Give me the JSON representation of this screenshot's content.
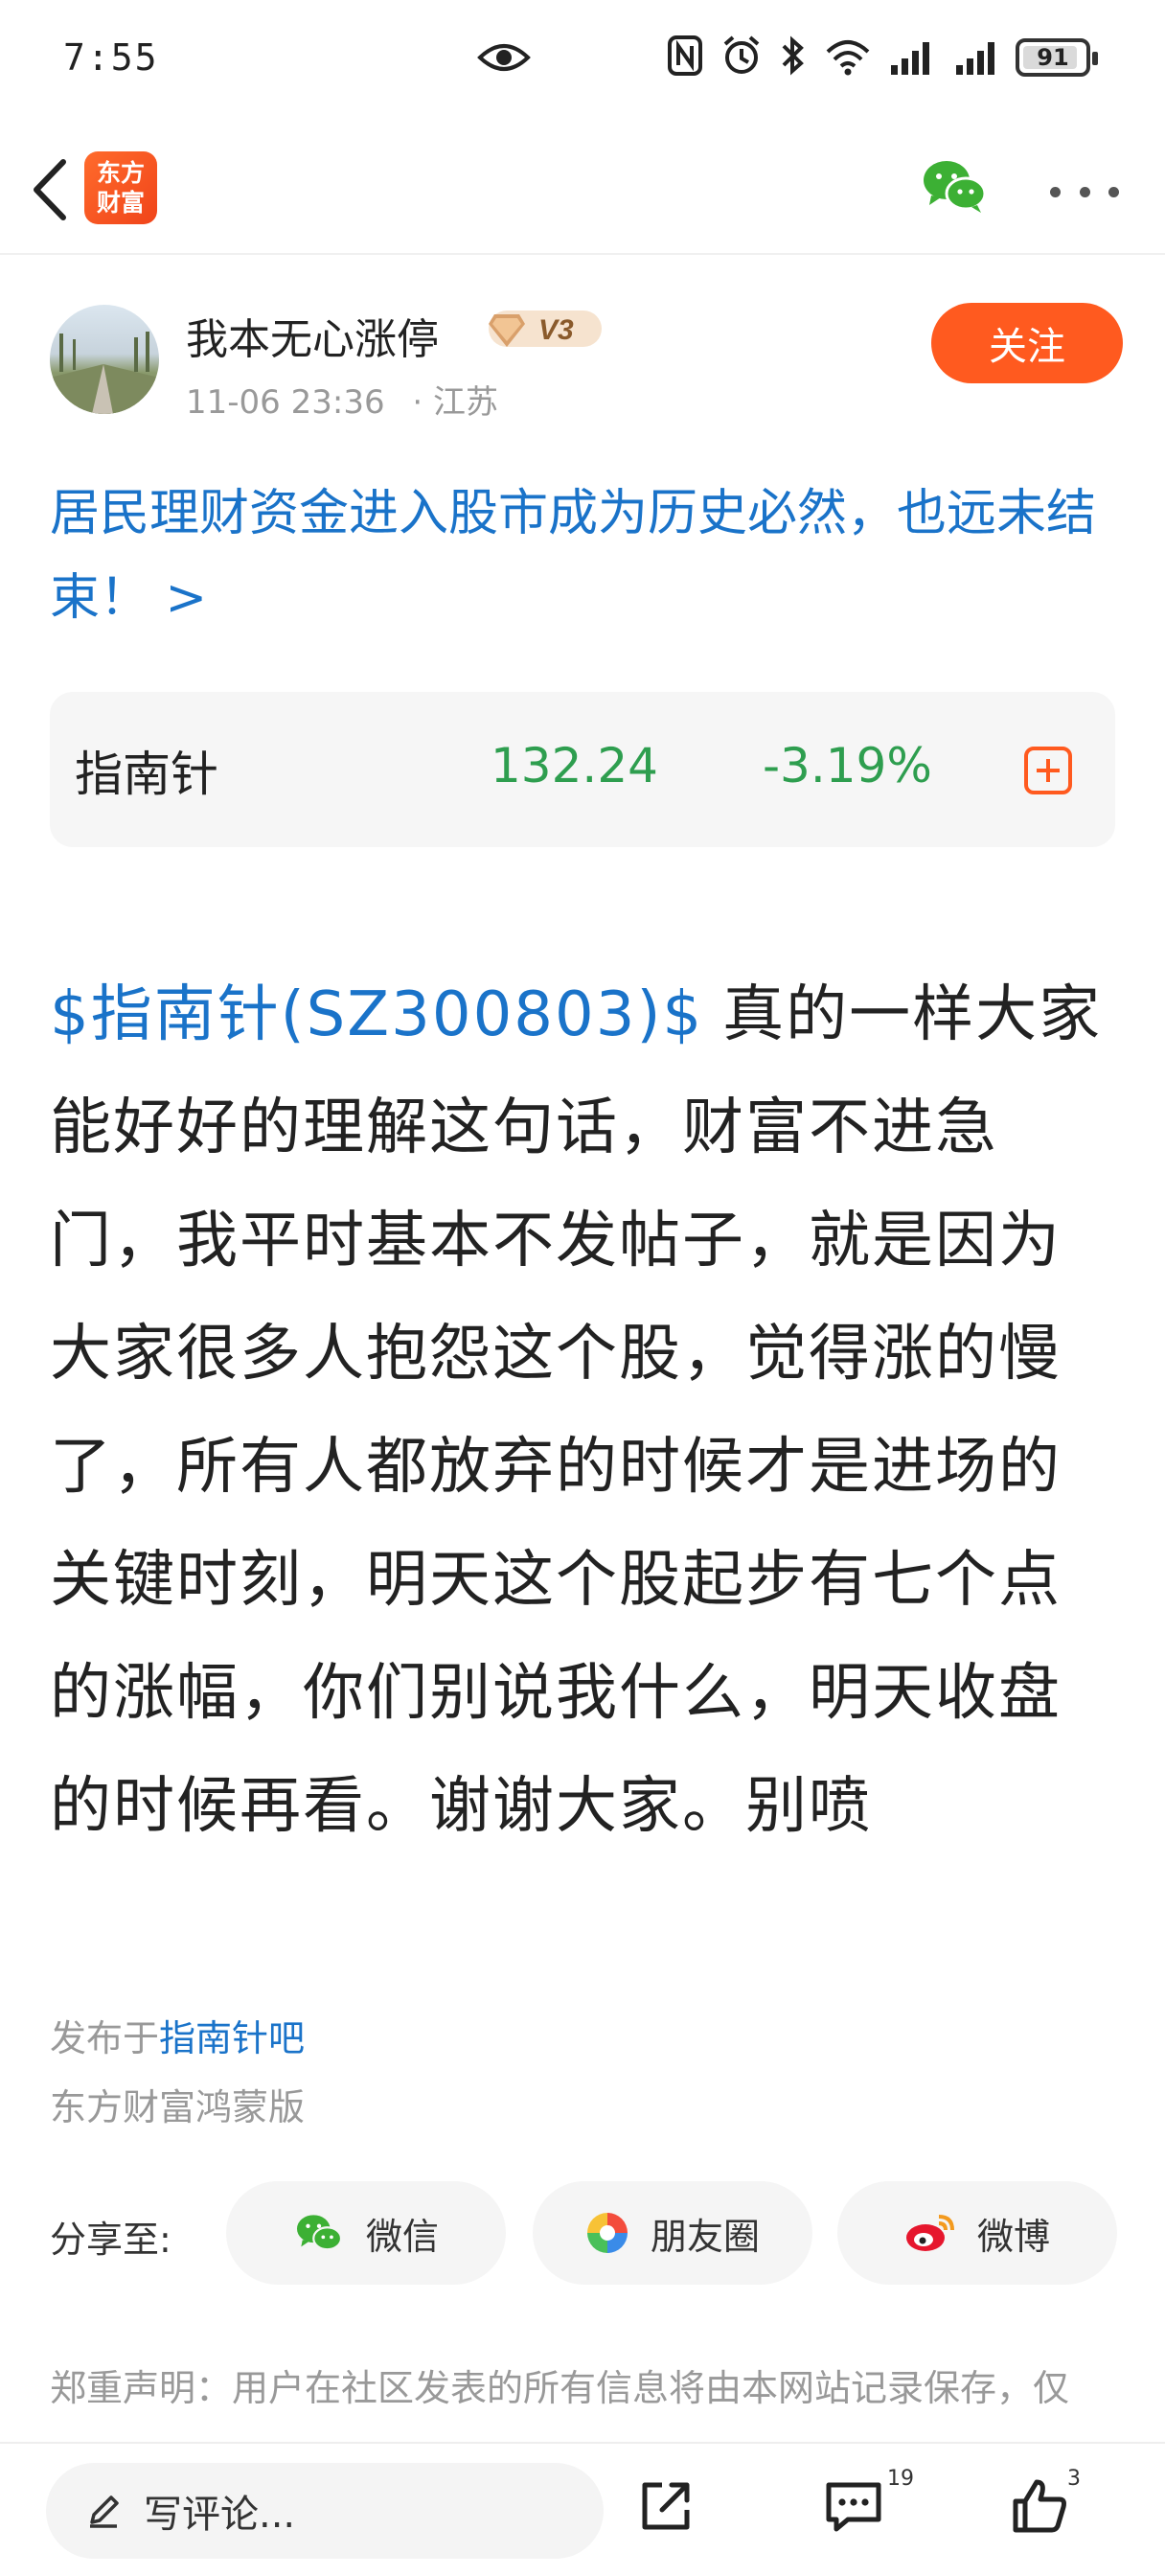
{
  "status_bar": {
    "time": "7:55",
    "battery": "91",
    "battery_level": 0.91,
    "icons": [
      "eye-icon",
      "nfc-icon",
      "alarm-icon",
      "bluetooth-icon",
      "wifi-icon",
      "signal-icon",
      "signal-icon",
      "battery-icon"
    ]
  },
  "nav": {
    "logo_line1": "东方",
    "logo_line2": "财富",
    "logo_color": "#f5501e",
    "wechat_color": "#3cb034"
  },
  "author": {
    "name": "我本无心涨停",
    "level": "V3",
    "timestamp": "11-06 23:36",
    "location": "· 江苏",
    "follow_label": "关注"
  },
  "headline": "居民理财资金进入股市成为历史必然，也远未结束！ >",
  "stock": {
    "name": "指南针",
    "price": "132.24",
    "change": "-3.19%",
    "down_color": "#2e9e4f"
  },
  "post": {
    "stock_tag": "$指南针(SZ300803)$",
    "text": "真的一样大家能好好的理解这句话，财富不进急门，我平时基本不发帖子，就是因为大家很多人抱怨这个股，觉得涨的慢了，所有人都放弃的时候才是进场的关键时刻，明天这个股起步有七个点的涨幅，你们别说我什么，明天收盘的时候再看。谢谢大家。别喷"
  },
  "footer": {
    "published_prefix": "发布于",
    "forum": "指南针吧",
    "client": "东方财富鸿蒙版"
  },
  "share": {
    "label": "分享至:",
    "wechat": "微信",
    "moments": "朋友圈",
    "weibo": "微博"
  },
  "disclaimer": "郑重声明：用户在社区发表的所有信息将由本网站记录保存，仅",
  "bottom_bar": {
    "comment_placeholder": "写评论...",
    "comment_count": "19",
    "like_count": "3"
  },
  "accent_blue": "#1a73c9",
  "accent_orange": "#ff5a1f"
}
